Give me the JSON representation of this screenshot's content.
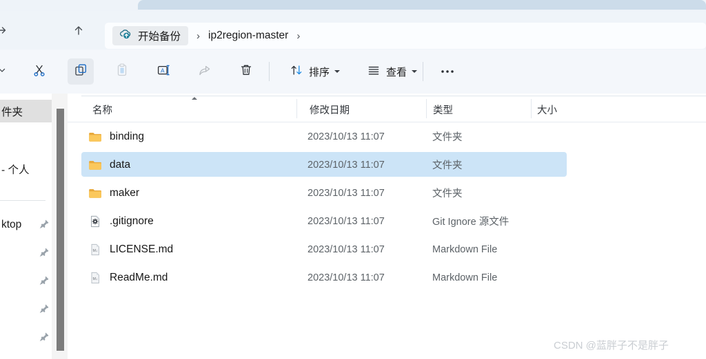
{
  "window": {
    "tabstrip_present": true
  },
  "nav": {
    "forward_icon": "arrow-right-icon",
    "up_icon": "arrow-up-icon",
    "refresh_icon": "refresh-icon"
  },
  "address": {
    "backup_icon": "cloud-upload-icon",
    "backup_label": "开始备份",
    "separator": "›",
    "path_label": "ip2region-master",
    "trailing_separator": "›"
  },
  "toolbar": {
    "overflow_left_icon": "chevron-down-icon",
    "cut_icon": "scissors-icon",
    "copy_icon": "copy-icon",
    "paste_icon": "clipboard-icon",
    "rename_icon": "rename-icon",
    "share_icon": "share-icon",
    "delete_icon": "trash-icon",
    "sort_icon": "sort-arrows-icon",
    "sort_label": "排序",
    "view_icon": "list-lines-icon",
    "view_label": "查看",
    "more_icon": "ellipsis-icon"
  },
  "sidebar": {
    "items": [
      {
        "label": "件夹",
        "selected": true,
        "pinned": false
      },
      {
        "label": "- 个人",
        "selected": false,
        "pinned": false
      },
      {
        "label": "ktop",
        "selected": false,
        "pinned": true
      },
      {
        "label": "",
        "selected": false,
        "pinned": true
      },
      {
        "label": "",
        "selected": false,
        "pinned": true
      },
      {
        "label": "",
        "selected": false,
        "pinned": true
      },
      {
        "label": "",
        "selected": false,
        "pinned": true
      }
    ],
    "pin_icon": "pin-icon",
    "scrollbar": "vertical-scrollbar"
  },
  "filelist": {
    "columns": [
      {
        "key": "name",
        "label": "名称",
        "sorted": "asc"
      },
      {
        "key": "date",
        "label": "修改日期",
        "sorted": ""
      },
      {
        "key": "type",
        "label": "类型",
        "sorted": ""
      },
      {
        "key": "size",
        "label": "大小",
        "sorted": ""
      }
    ],
    "rows": [
      {
        "name": "binding",
        "date": "2023/10/13 11:07",
        "type": "文件夹",
        "size": "",
        "icon": "folder-icon",
        "selected": false
      },
      {
        "name": "data",
        "date": "2023/10/13 11:07",
        "type": "文件夹",
        "size": "",
        "icon": "folder-icon",
        "selected": true
      },
      {
        "name": "maker",
        "date": "2023/10/13 11:07",
        "type": "文件夹",
        "size": "",
        "icon": "folder-icon",
        "selected": false
      },
      {
        "name": ".gitignore",
        "date": "2023/10/13 11:07",
        "type": "Git Ignore 源文件",
        "size": "",
        "icon": "gitignore-icon",
        "selected": false
      },
      {
        "name": "LICENSE.md",
        "date": "2023/10/13 11:07",
        "type": "Markdown File",
        "size": "",
        "icon": "markdown-icon",
        "selected": false
      },
      {
        "name": "ReadMe.md",
        "date": "2023/10/13 11:07",
        "type": "Markdown File",
        "size": "",
        "icon": "markdown-icon",
        "selected": false
      }
    ]
  },
  "watermark": {
    "text": "CSDN @蓝胖子不是胖子"
  },
  "colors": {
    "selection": "#cce4f7",
    "folder": "#ffc95e",
    "accent": "#0f78d4",
    "chrome": "#eff4f9"
  }
}
